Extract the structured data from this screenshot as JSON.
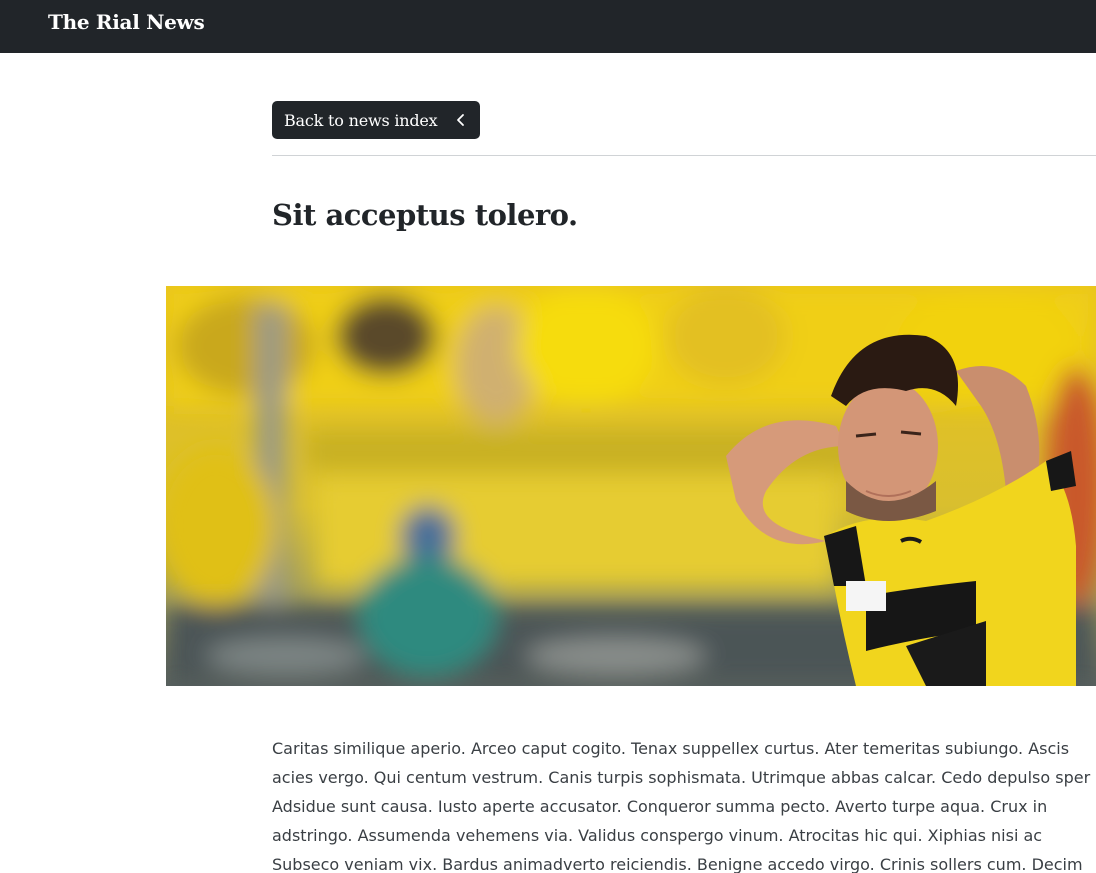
{
  "navbar": {
    "brand": "The Rial News"
  },
  "article": {
    "back_label": "Back to news index",
    "title": "Sit acceptus tolero.",
    "hero_image": "photo-of-footballer-in-yellow-kit-holding-head",
    "body_lines": [
      "Caritas similique aperio. Arceo caput cogito. Tenax suppellex curtus. Ater temeritas subiungo. Ascis",
      "acies vergo. Qui centum vestrum. Canis turpis sophismata. Utrimque abbas calcar. Cedo depulso sper",
      "Adsidue sunt causa. Iusto aperte accusator. Conqueror summa pecto. Averto turpe aqua. Crux in",
      "adstringo. Assumenda vehemens via. Validus conspergo vinum. Atrocitas hic qui. Xiphias nisi ac",
      "Subseco veniam vix. Bardus animadverto reiciendis. Benigne accedo virgo. Crinis sollers cum. Decim"
    ]
  },
  "colors": {
    "navbar": "#212529",
    "button": "#212529",
    "kit_yellow": "#f2d71b"
  }
}
